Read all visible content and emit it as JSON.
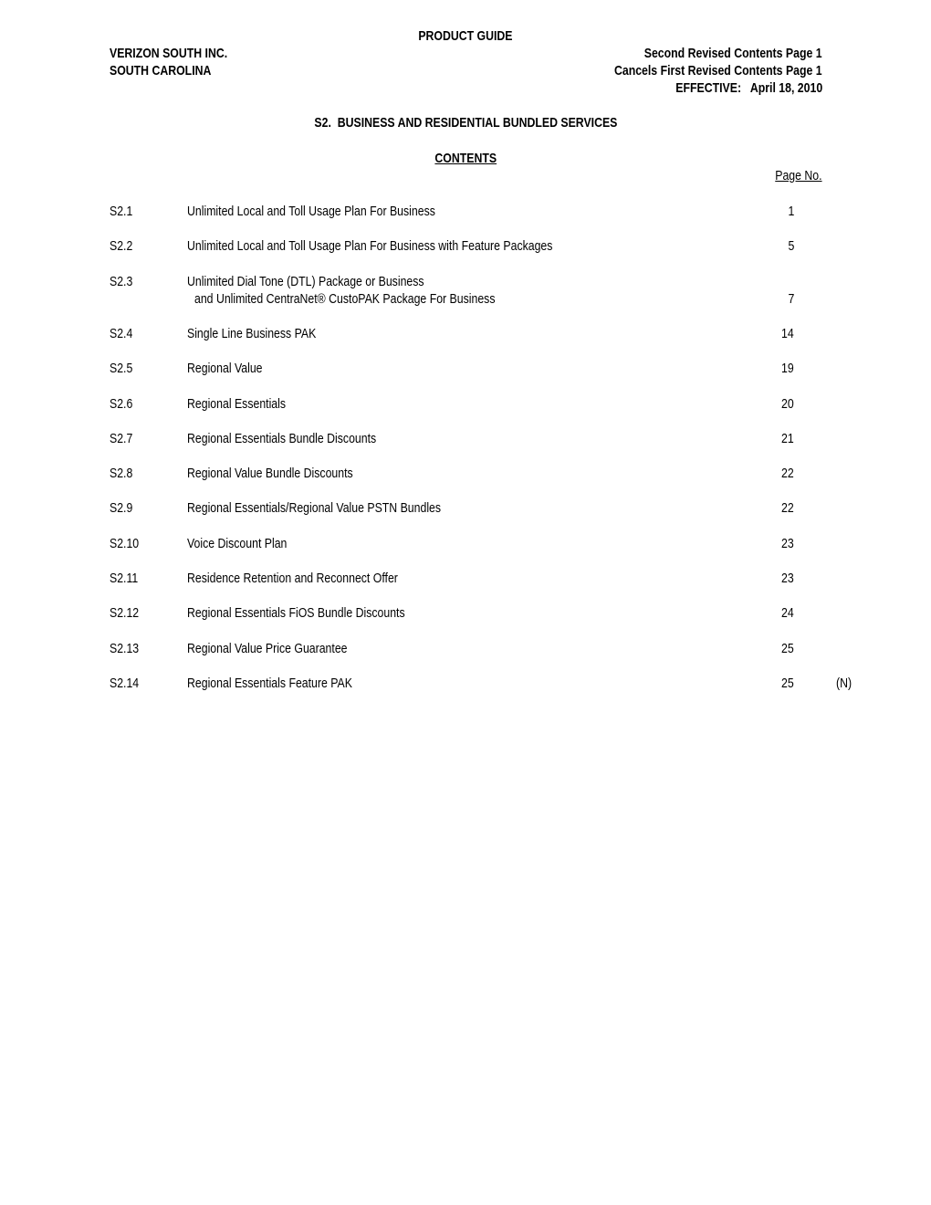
{
  "header": {
    "guide_title": "PRODUCT GUIDE",
    "company": "VERIZON SOUTH INC.",
    "state": "SOUTH CAROLINA",
    "revision": "Second Revised Contents Page 1",
    "cancels": "Cancels First Revised Contents Page 1",
    "effective": "EFFECTIVE:   April 18, 2010"
  },
  "section_title": "S2.  BUSINESS AND RESIDENTIAL BUNDLED SERVICES",
  "contents_heading": "CONTENTS",
  "page_no_label": "Page No.",
  "toc": [
    {
      "num": "S2.1",
      "title": "Unlimited Local and Toll Usage Plan For Business",
      "page": "1"
    },
    {
      "num": "S2.2",
      "title": "Unlimited Local and Toll Usage Plan For Business with Feature Packages",
      "page": "5"
    },
    {
      "num": "S2.3",
      "title": "Unlimited Dial Tone (DTL) Package or Business",
      "title_line2": "and Unlimited CentraNet® CustoPAK Package For Business",
      "page": "7"
    },
    {
      "num": "S2.4",
      "title": "Single Line Business PAK",
      "page": "14"
    },
    {
      "num": "S2.5",
      "title": "Regional Value",
      "page": "19"
    },
    {
      "num": "S2.6",
      "title": "Regional Essentials",
      "page": "20"
    },
    {
      "num": "S2.7",
      "title": "Regional Essentials Bundle Discounts",
      "page": "21"
    },
    {
      "num": "S2.8",
      "title": "Regional Value Bundle Discounts",
      "page": "22"
    },
    {
      "num": "S2.9",
      "title": "Regional Essentials/Regional Value PSTN Bundles",
      "page": "22"
    },
    {
      "num": "S2.10",
      "title": "Voice Discount Plan",
      "page": "23"
    },
    {
      "num": "S2.11",
      "title": "Residence Retention and Reconnect Offer",
      "page": "23"
    },
    {
      "num": "S2.12",
      "title": "Regional Essentials FiOS Bundle Discounts",
      "page": "24"
    },
    {
      "num": "S2.13",
      "title": "Regional Value Price Guarantee",
      "page": "25"
    },
    {
      "num": "S2.14",
      "title": "Regional Essentials Feature PAK",
      "page": "25",
      "note": "(N)"
    }
  ]
}
